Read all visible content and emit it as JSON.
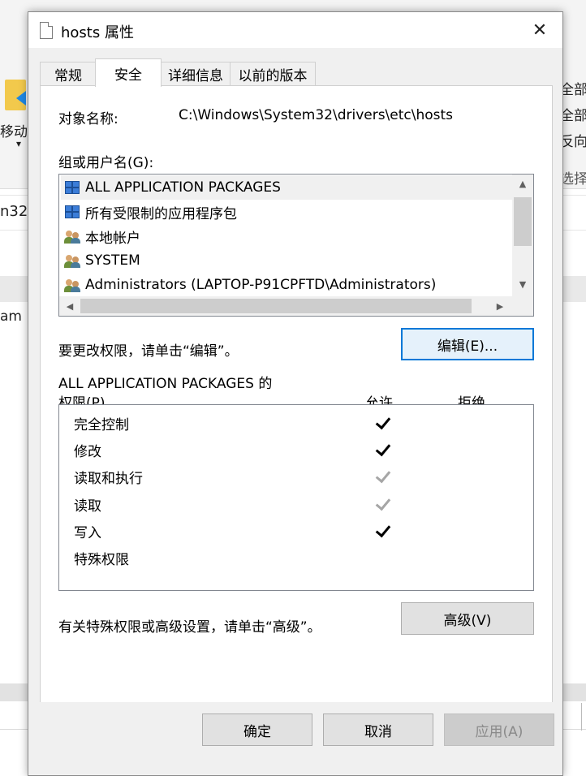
{
  "background": {
    "ribbon_right": [
      "全部选",
      "全部取",
      "反向选"
    ],
    "select_label": "选择",
    "move_label": "移动到",
    "address_fragment": "n32",
    "list_fragment": "am"
  },
  "dialog": {
    "title": "hosts 属性",
    "close_glyph": "✕",
    "tabs": [
      "常规",
      "安全",
      "详细信息",
      "以前的版本"
    ],
    "active_tab": 1,
    "object_name_label": "对象名称:",
    "object_name_value": "C:\\Windows\\System32\\drivers\\etc\\hosts",
    "groups_label": "组或用户名(G):",
    "users": [
      {
        "name": "ALL APPLICATION PACKAGES",
        "icon": "package-icon",
        "selected": true
      },
      {
        "name": "所有受限制的应用程序包",
        "icon": "package-icon",
        "selected": false
      },
      {
        "name": "本地帐户",
        "icon": "user-group-icon",
        "selected": false
      },
      {
        "name": "SYSTEM",
        "icon": "user-group-icon",
        "selected": false
      },
      {
        "name": "Administrators (LAPTOP-P91CPFTD\\Administrators)",
        "icon": "user-group-icon",
        "selected": false
      }
    ],
    "change_hint": "要更改权限，请单击“编辑”。",
    "edit_button": "编辑(E)...",
    "perm_title_line1": "ALL APPLICATION PACKAGES 的",
    "perm_title_line2": "权限(P)",
    "col_allow": "允许",
    "col_deny": "拒绝",
    "permissions": [
      {
        "name": "完全控制",
        "allow": "checked",
        "deny": "none"
      },
      {
        "name": "修改",
        "allow": "checked",
        "deny": "none"
      },
      {
        "name": "读取和执行",
        "allow": "inherited",
        "deny": "none"
      },
      {
        "name": "读取",
        "allow": "inherited",
        "deny": "none"
      },
      {
        "name": "写入",
        "allow": "checked",
        "deny": "none"
      },
      {
        "name": "特殊权限",
        "allow": "none",
        "deny": "none"
      }
    ],
    "advanced_hint": "有关特殊权限或高级设置，请单击“高级”。",
    "advanced_button": "高级(V)",
    "ok_button": "确定",
    "cancel_button": "取消",
    "apply_button": "应用(A)"
  }
}
